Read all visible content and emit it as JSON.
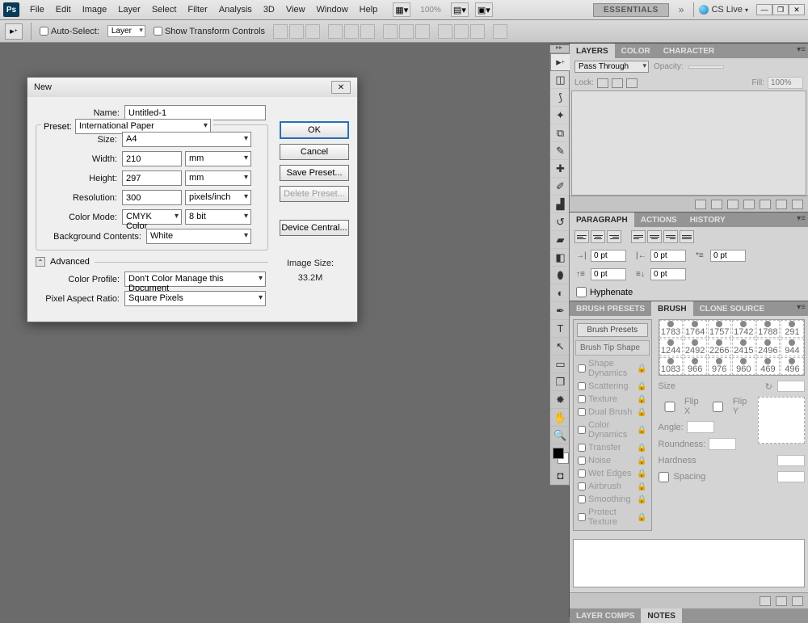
{
  "menu": [
    "File",
    "Edit",
    "Image",
    "Layer",
    "Select",
    "Filter",
    "Analysis",
    "3D",
    "View",
    "Window",
    "Help"
  ],
  "top": {
    "zoom": "100%",
    "essentials": "ESSENTIALS",
    "cslive": "CS Live"
  },
  "options": {
    "auto_select": "Auto-Select:",
    "auto_select_val": "Layer",
    "show_transform": "Show Transform Controls"
  },
  "dialog": {
    "title": "New",
    "name_lbl": "Name:",
    "name_val": "Untitled-1",
    "preset_lbl": "Preset:",
    "preset_val": "International Paper",
    "size_lbl": "Size:",
    "size_val": "A4",
    "width_lbl": "Width:",
    "width_val": "210",
    "width_unit": "mm",
    "height_lbl": "Height:",
    "height_val": "297",
    "height_unit": "mm",
    "res_lbl": "Resolution:",
    "res_val": "300",
    "res_unit": "pixels/inch",
    "mode_lbl": "Color Mode:",
    "mode_val": "CMYK Color",
    "depth_val": "8 bit",
    "bg_lbl": "Background Contents:",
    "bg_val": "White",
    "advanced": "Advanced",
    "profile_lbl": "Color Profile:",
    "profile_val": "Don't Color Manage this Document",
    "par_lbl": "Pixel Aspect Ratio:",
    "par_val": "Square Pixels",
    "ok": "OK",
    "cancel": "Cancel",
    "save_preset": "Save Preset...",
    "delete_preset": "Delete Preset...",
    "device_central": "Device Central...",
    "img_size_lbl": "Image Size:",
    "img_size_val": "33.2M"
  },
  "panels": {
    "layers_tabs": [
      "LAYERS",
      "COLOR",
      "CHARACTER"
    ],
    "blend_mode": "Pass Through",
    "opacity_lbl": "Opacity:",
    "lock_lbl": "Lock:",
    "fill_lbl": "Fill:",
    "fill_val": "100%",
    "paragraph_tabs": [
      "PARAGRAPH",
      "ACTIONS",
      "HISTORY"
    ],
    "pt": "0 pt",
    "hyphenate": "Hyphenate",
    "brush_tabs": [
      "BRUSH PRESETS",
      "BRUSH",
      "CLONE SOURCE"
    ],
    "brush_presets_btn": "Brush Presets",
    "brush_tip": "Brush Tip Shape",
    "brush_opts": [
      "Shape Dynamics",
      "Scattering",
      "Texture",
      "Dual Brush",
      "Color Dynamics",
      "Transfer",
      "Noise",
      "Wet Edges",
      "Airbrush",
      "Smoothing",
      "Protect Texture"
    ],
    "brush_sizes": [
      "1783",
      "1764",
      "1757",
      "1742",
      "1788",
      "291",
      "1244",
      "2492",
      "2266",
      "2415",
      "2496",
      "944",
      "1083",
      "966",
      "976",
      "960",
      "469",
      "496"
    ],
    "size_lbl": "Size",
    "flipx": "Flip X",
    "flipy": "Flip Y",
    "angle": "Angle:",
    "roundness": "Roundness:",
    "hardness": "Hardness",
    "spacing": "Spacing",
    "bottom_tabs": [
      "LAYER COMPS",
      "NOTES"
    ]
  }
}
